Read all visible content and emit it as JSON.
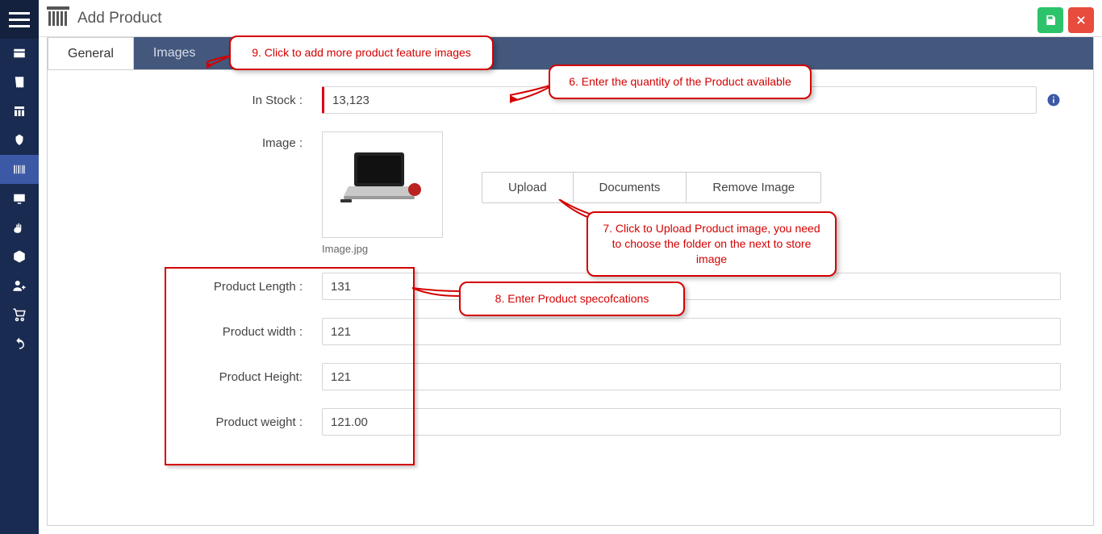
{
  "header": {
    "title": "Add Product"
  },
  "tabs": {
    "general": "General",
    "images": "Images"
  },
  "form": {
    "in_stock_label": "In Stock :",
    "in_stock_value": "13,123",
    "image_label": "Image :",
    "image_caption": "Image.jpg",
    "upload_btn": "Upload",
    "documents_btn": "Documents",
    "remove_btn": "Remove Image",
    "length_label": "Product Length :",
    "length_value": "131",
    "width_label": "Product width :",
    "width_value": "121",
    "height_label": "Product Height:",
    "height_value": "121",
    "weight_label": "Product weight :",
    "weight_value": "121.00"
  },
  "callouts": {
    "c9": "9. Click to add more product feature images",
    "c6": "6.  Enter the quantity of the Product available",
    "c7": "7.  Click to Upload Product image, you need to choose the folder on the next to store image",
    "c8": "8. Enter Product specofcations"
  }
}
